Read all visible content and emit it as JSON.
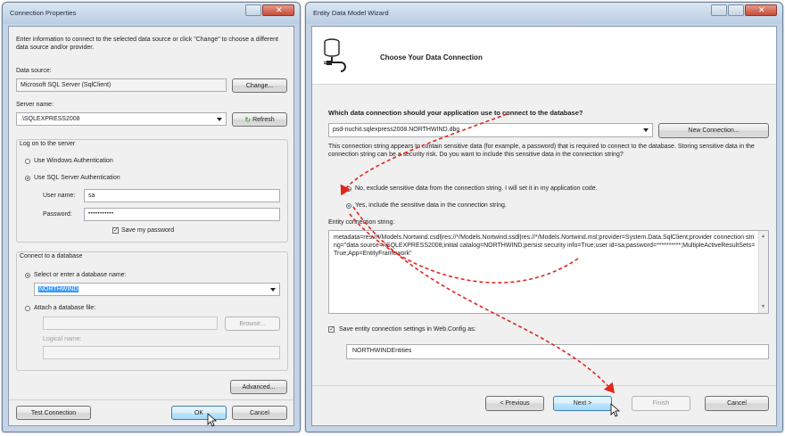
{
  "left_dialog": {
    "title": "Connection Properties",
    "instructions": "Enter information to connect to the selected data source or click \"Change\" to choose a different data source and/or provider.",
    "data_source_label": "Data source:",
    "data_source_value": "Microsoft SQL Server (SqlClient)",
    "change_button": "Change...",
    "server_name_label": "Server name:",
    "server_name_value": ".\\SQLEXPRESS2008",
    "refresh_button": "Refresh",
    "logon_group_label": "Log on to the server",
    "windows_auth_label": "Use Windows Authentication",
    "sql_auth_label": "Use SQL Server Authentication",
    "user_name_label": "User name:",
    "user_name_value": "sa",
    "password_label": "Password:",
    "password_value": "•••••••••••",
    "save_password_label": "Save my password",
    "connect_group_label": "Connect to a database",
    "select_db_label": "Select or enter a database name:",
    "db_name_value": "NORTHWIND",
    "attach_db_label": "Attach a database file:",
    "browse_button": "Browse...",
    "logical_name_label": "Logical name:",
    "advanced_button": "Advanced...",
    "test_connection_button": "Test Connection",
    "ok_button": "OK",
    "cancel_button": "Cancel"
  },
  "right_dialog": {
    "title": "Entity Data Model Wizard",
    "header_title": "Choose Your Data Connection",
    "question": "Which data connection should your application use to connect to the database?",
    "connection_value": "psd-nuchit.sqlexpress2008.NORTHWIND.dbo",
    "new_connection_button": "New Connection...",
    "sensitive_text": "This connection string appears to contain sensitive data (for example, a password) that is required to connect to the database. Storing sensitive data in the connection string can be a security risk. Do you want to include this sensitive data in the connection string?",
    "exclude_option": "No, exclude sensitive data from the connection string. I will set it in my application code.",
    "include_option": "Yes, include the sensitive data in the connection string.",
    "ecs_label": "Entity connection string:",
    "ecs_value": "metadata=res://*/Models.Nortwind.csdl|res://*/Models.Nortwind.ssdl|res://*/Models.Nortwind.msl;provider=System.Data.SqlClient;provider connection string=\"data source=.\\SQLEXPRESS2008;initial catalog=NORTHWIND;persist security info=True;user id=sa;password=**********;MultipleActiveResultSets=True;App=EntityFramework\"",
    "save_settings_label": "Save entity connection settings in Web.Config as:",
    "entities_name": "NORTHWINDEntities",
    "previous_button": "< Previous",
    "next_button": "Next >",
    "finish_button": "Finish",
    "cancel_button": "Cancel"
  },
  "colors": {
    "annotation_arrow": "#e0261e",
    "selection": "#3399ff"
  }
}
